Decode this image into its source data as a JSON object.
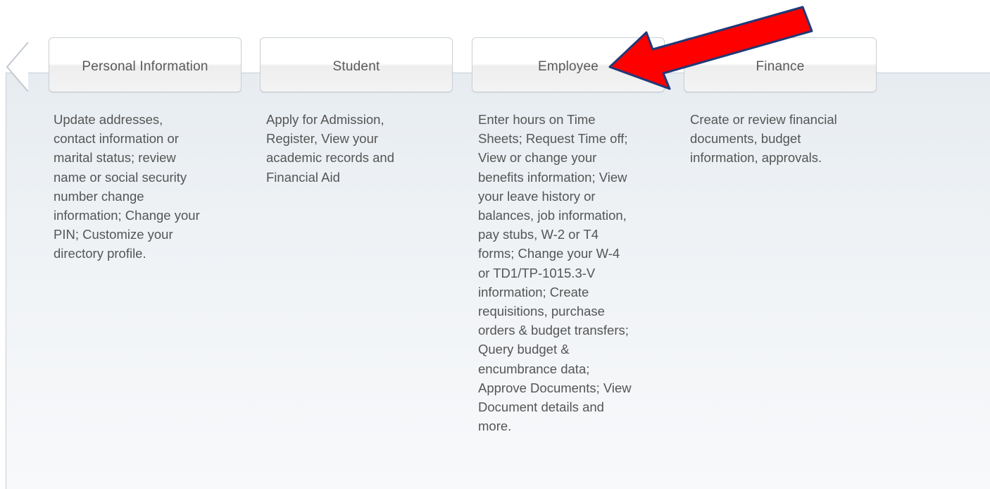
{
  "tabs": [
    {
      "label": "Personal Information",
      "description": "Update addresses,\ncontact information or\nmarital status; review\nname or social security\nnumber change\ninformation; Change your\nPIN; Customize your\ndirectory profile."
    },
    {
      "label": "Student",
      "description": "Apply for Admission,\nRegister, View your\nacademic records and\nFinancial Aid"
    },
    {
      "label": "Employee",
      "description": "Enter hours on Time\nSheets; Request Time off;\nView or change your\nbenefits information; View\nyour leave history or\nbalances, job information,\npay stubs, W-2 or T4\nforms; Change your W-4\nor TD1/TP-1015.3-V\ninformation; Create\nrequisitions, purchase\norders & budget transfers;\nQuery budget &\nencumbrance data;\nApprove Documents; View\nDocument details and\nmore."
    },
    {
      "label": "Finance",
      "description": "Create or review financial\ndocuments, budget\ninformation, approvals."
    }
  ],
  "annotation": {
    "arrow_color": "#ff0000",
    "arrow_outline": "#1f3a78",
    "target": "Employee"
  },
  "icons": {
    "prev": "chevron-left-icon",
    "annotation": "arrow-pointer-icon"
  }
}
